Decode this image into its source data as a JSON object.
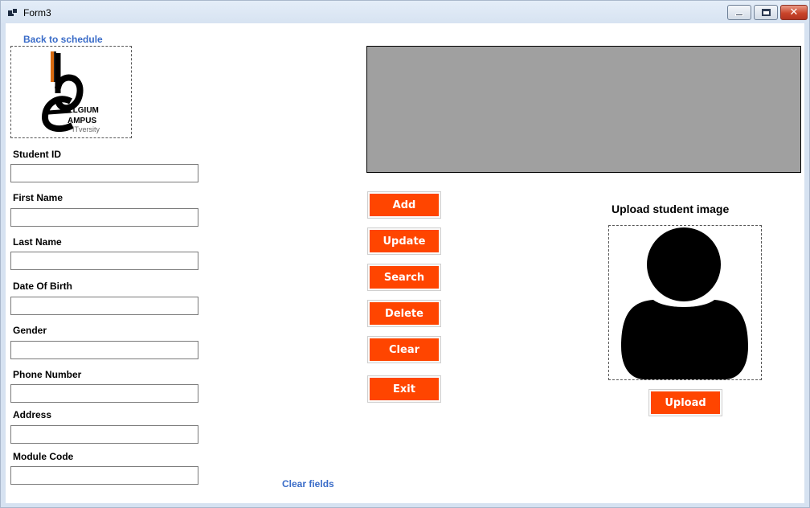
{
  "window": {
    "title": "Form3",
    "icons": {
      "app": "form-icon",
      "minimize": "minimize-icon",
      "maximize": "restore-icon",
      "close": "close-icon"
    }
  },
  "nav": {
    "back_link": "Back to schedule"
  },
  "logo": {
    "line1": "ELGIUM",
    "line2": "AMPUS",
    "line3": "ITversity",
    "colors": {
      "black": "#000000",
      "orange": "#d86a10"
    }
  },
  "form": {
    "fields": [
      {
        "label": "Student ID",
        "value": ""
      },
      {
        "label": "First Name",
        "value": ""
      },
      {
        "label": "Last Name",
        "value": ""
      },
      {
        "label": "Date Of Birth",
        "value": ""
      },
      {
        "label": "Gender",
        "value": ""
      },
      {
        "label": "Phone Number",
        "value": ""
      },
      {
        "label": "Address",
        "value": ""
      },
      {
        "label": "Module Code",
        "value": ""
      }
    ],
    "clear_link": "Clear fields"
  },
  "actions": {
    "add": "Add",
    "update": "Update",
    "search": "Search",
    "delete": "Delete",
    "clear": "Clear",
    "exit": "Exit"
  },
  "photo": {
    "title": "Upload student image",
    "upload_button": "Upload",
    "placeholder_icon": "user-silhouette-icon"
  },
  "colors": {
    "accent": "#ff4500",
    "link": "#3a6cc8",
    "banner": "#a0a0a0"
  }
}
